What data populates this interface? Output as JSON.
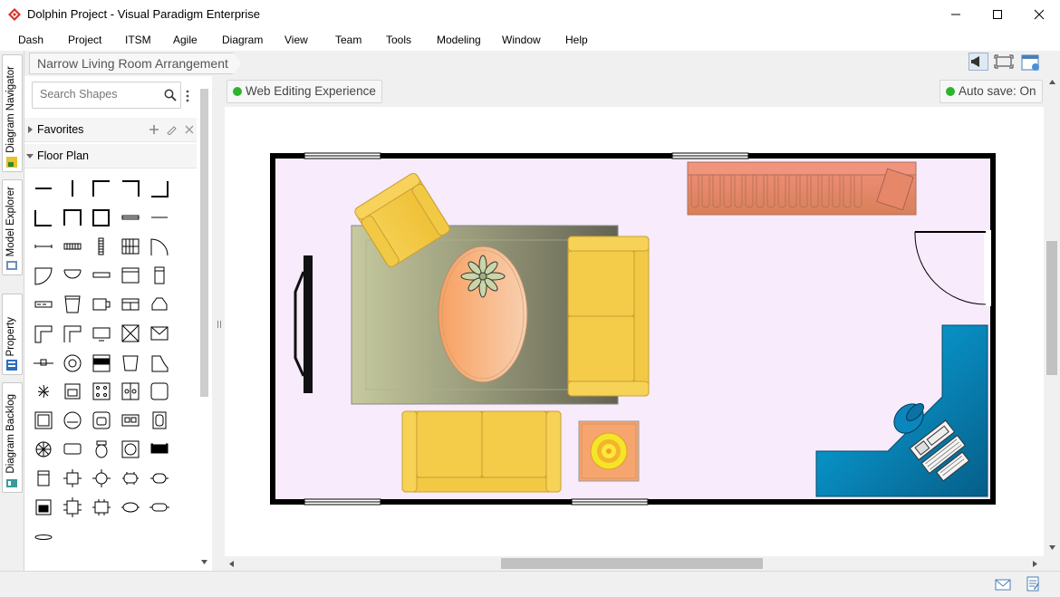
{
  "window": {
    "title": "Dolphin Project - Visual Paradigm Enterprise",
    "minimize_icon": "minimize-icon",
    "maximize_icon": "maximize-icon",
    "close_icon": "close-icon"
  },
  "menu": [
    "Dash",
    "Project",
    "ITSM",
    "Agile",
    "Diagram",
    "View",
    "Team",
    "Tools",
    "Modeling",
    "Window",
    "Help"
  ],
  "side_tabs": [
    {
      "label": "Diagram Navigator",
      "icon": "diagram-navigator-icon"
    },
    {
      "label": "Model Explorer",
      "icon": "model-explorer-icon"
    },
    {
      "label": "Property",
      "icon": "property-icon"
    },
    {
      "label": "Diagram Backlog",
      "icon": "diagram-backlog-icon"
    }
  ],
  "breadcrumb": {
    "diagram_name": "Narrow Living Room Arrangement"
  },
  "shape_panel": {
    "search_placeholder": "Search Shapes",
    "search_value": "",
    "sections": [
      {
        "label": "Favorites",
        "expanded": false
      },
      {
        "label": "Floor Plan",
        "expanded": true
      }
    ]
  },
  "canvas_status": {
    "web_editing": "Web Editing Experience",
    "auto_save": "Auto save: On",
    "indicator_color": "#2cb52c"
  },
  "colors": {
    "room_floor": "#f7ebfc",
    "wall": "#000000",
    "sofa": "#f0c030",
    "rug_left": "#c4c89c",
    "rug_right": "#6a6a58",
    "desk": "#0a7ab0",
    "couch": "#e38c6c"
  }
}
